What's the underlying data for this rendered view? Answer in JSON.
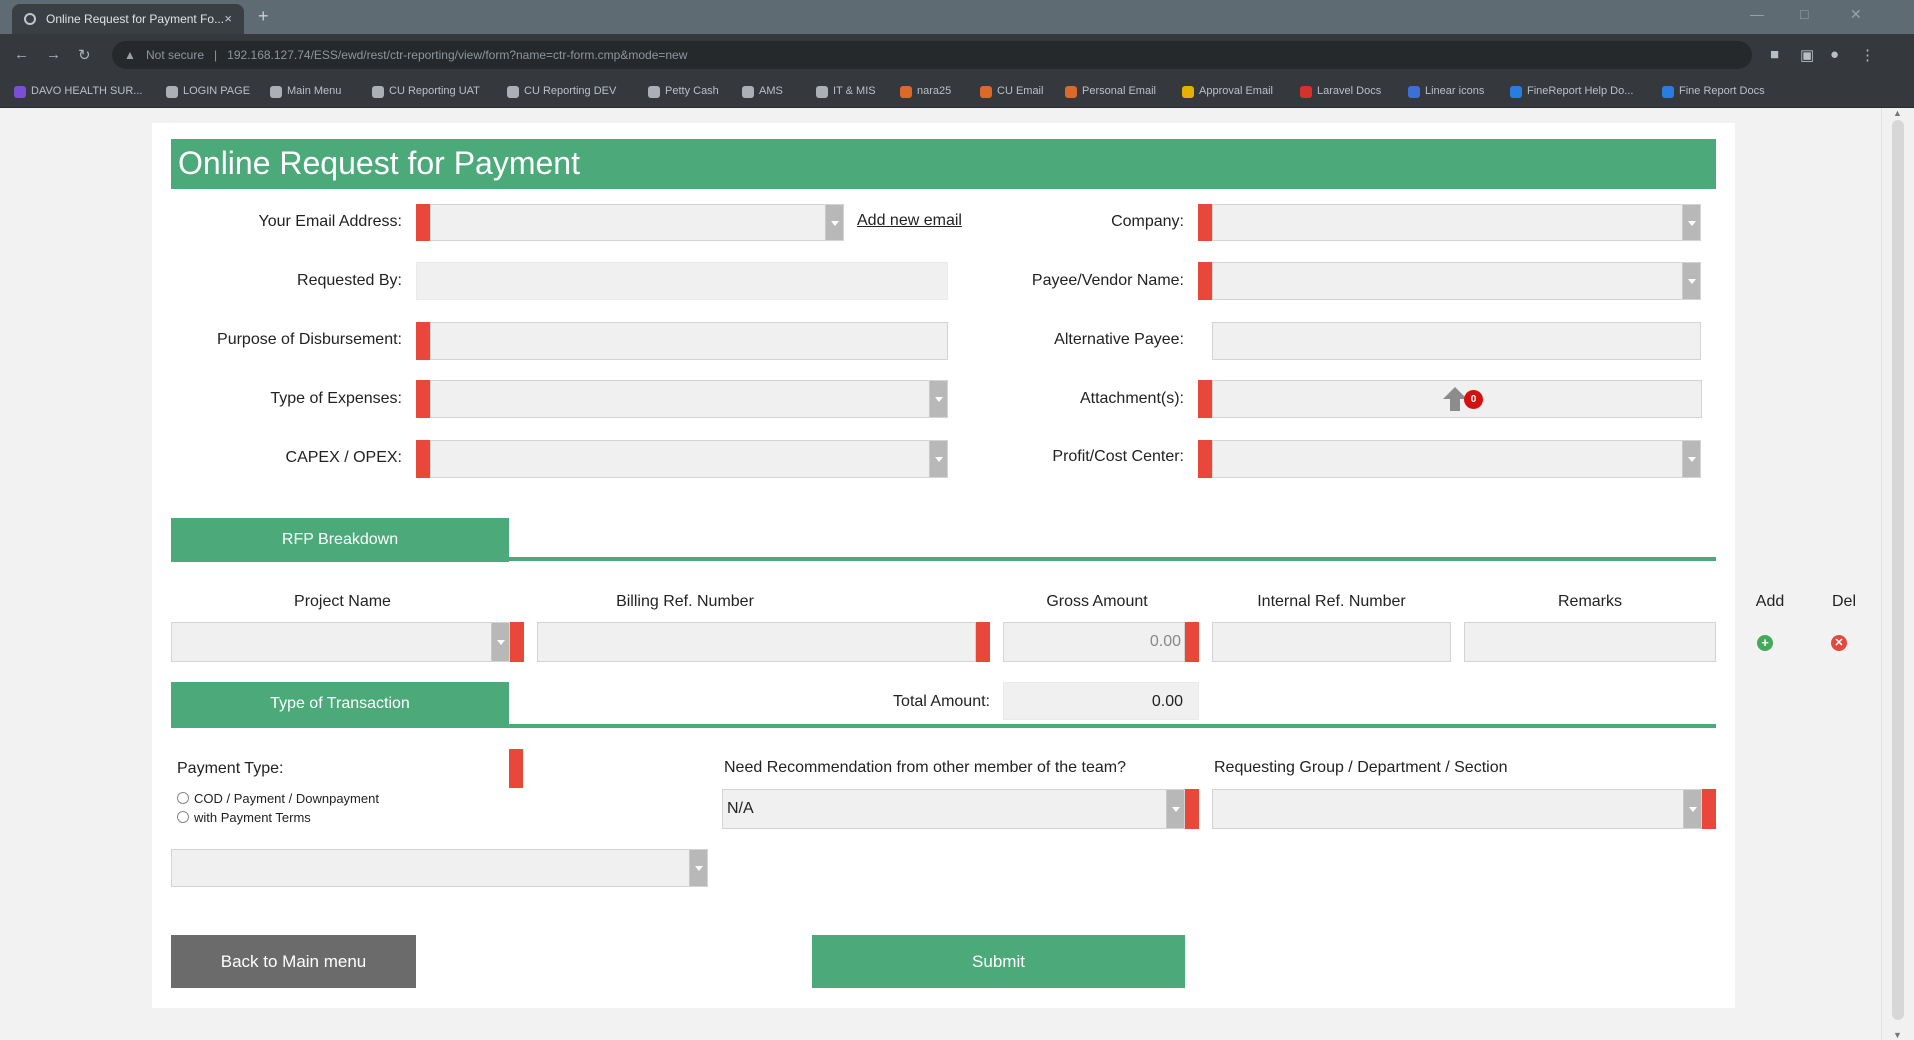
{
  "browser": {
    "tab_title": "Online Request for Payment Fo...",
    "tab_close": "×",
    "new_tab": "+",
    "url_security": "Not secure",
    "url": "192.168.127.74/ESS/ewd/rest/ctr-reporting/view/form?name=ctr-form.cmp&mode=new",
    "bookmarks": [
      {
        "label": "DAVO HEALTH SUR...",
        "color": "#7a4fd6"
      },
      {
        "label": "LOGIN PAGE",
        "color": "#aab0b6"
      },
      {
        "label": "Main Menu",
        "color": "#aab0b6"
      },
      {
        "label": "CU Reporting UAT",
        "color": "#aab0b6"
      },
      {
        "label": "CU Reporting DEV",
        "color": "#aab0b6"
      },
      {
        "label": "Petty Cash",
        "color": "#aab0b6"
      },
      {
        "label": "AMS",
        "color": "#aab0b6"
      },
      {
        "label": "IT & MIS",
        "color": "#aab0b6"
      },
      {
        "label": "nara25",
        "color": "#d96a2a"
      },
      {
        "label": "CU Email",
        "color": "#d96a2a"
      },
      {
        "label": "Personal Email",
        "color": "#d96a2a"
      },
      {
        "label": "Approval Email",
        "color": "#e6b000"
      },
      {
        "label": "Laravel Docs",
        "color": "#d6312b"
      },
      {
        "label": "Linear icons",
        "color": "#3d6fd8"
      },
      {
        "label": "FineReport Help Do...",
        "color": "#2a7de0"
      },
      {
        "label": "Fine Report Docs",
        "color": "#2a7de0"
      }
    ]
  },
  "form": {
    "title": "Online Request for Payment",
    "labels": {
      "email": "Your Email Address:",
      "requested_by": "Requested By:",
      "purpose": "Purpose of Disbursement:",
      "type_expenses": "Type of Expenses:",
      "capex_opex": "CAPEX / OPEX:",
      "company": "Company:",
      "payee": "Payee/Vendor Name:",
      "alt_payee": "Alternative Payee:",
      "attachments": "Attachment(s):",
      "profit_center": "Profit/Cost Center:"
    },
    "add_email_link": "Add new email",
    "attachment_count": "0"
  },
  "breakdown": {
    "tab_label": "RFP Breakdown",
    "columns": [
      "Project Name",
      "Billing Ref. Number",
      "Gross Amount",
      "Internal Ref. Number",
      "Remarks",
      "Add",
      "Del"
    ],
    "row": {
      "gross_amount": "0.00"
    }
  },
  "transaction": {
    "tab_label": "Type of Transaction",
    "total_label": "Total Amount:",
    "total_value": "0.00",
    "payment_type_label": "Payment Type:",
    "payment_options": [
      "COD / Payment / Downpayment",
      "with Payment Terms"
    ],
    "recommendation_label": "Need Recommendation from other member of the team?",
    "recommendation_value": "N/A",
    "department_label": "Requesting Group / Department / Section"
  },
  "buttons": {
    "back": "Back to Main menu",
    "submit": "Submit"
  },
  "colors": {
    "accent_green": "#4caa7a",
    "required_red": "#e8473a",
    "back_button": "#6b6b6b"
  }
}
